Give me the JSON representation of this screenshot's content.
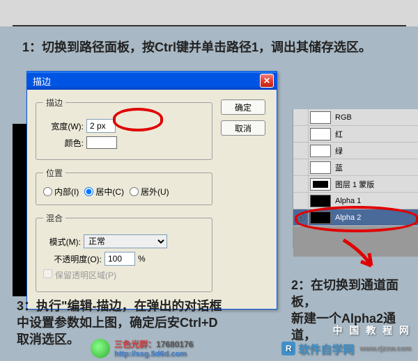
{
  "annotations": {
    "step1": "1：切换到路径面板，按Ctrl键并单击路径1，调出其储存选区。",
    "step2_l1": "2：在切换到通道面板，",
    "step2_l2": "新建一个Alpha2通道，",
    "step3_l1": "3：执行\"编辑-描边，在弹出的对话框",
    "step3_l2": "中设置参数如上图，确定后安Ctrl+D",
    "step3_l3": "取消选区。"
  },
  "dialog": {
    "title": "描边",
    "ok": "确定",
    "cancel": "取消",
    "stroke_legend": "描边",
    "width_label": "宽度(W):",
    "width_value": "2 px",
    "color_label": "颜色:",
    "position_legend": "位置",
    "pos_inside": "内部(I)",
    "pos_center": "居中(C)",
    "pos_outside": "居外(U)",
    "blend_legend": "混合",
    "mode_label": "模式(M):",
    "mode_value": "正常",
    "opacity_label": "不透明度(O):",
    "opacity_value": "100",
    "opacity_pct": "%",
    "preserve": "保留透明区域(P)"
  },
  "channels": {
    "items": [
      {
        "label": "RGB",
        "thumb": "white",
        "eye": false,
        "sel": false
      },
      {
        "label": "红",
        "thumb": "white",
        "eye": false,
        "sel": false
      },
      {
        "label": "绿",
        "thumb": "white",
        "eye": false,
        "sel": false
      },
      {
        "label": "蓝",
        "thumb": "white",
        "eye": false,
        "sel": false
      },
      {
        "label": "图层 1 蒙版",
        "thumb": "mask",
        "eye": false,
        "sel": false
      },
      {
        "label": "Alpha 1",
        "thumb": "black",
        "eye": false,
        "sel": false
      },
      {
        "label": "Alpha 2",
        "thumb": "black",
        "eye": true,
        "sel": true
      }
    ]
  },
  "watermarks": {
    "wm1": "中 国 教 程 网",
    "wm2_text": "软件自学网",
    "wm2_url": "www.rjzxw.com",
    "wm3_text": "三色光群：",
    "wm3_num": "17680176",
    "wm3_url": "http://ssg.5d6d.com"
  }
}
